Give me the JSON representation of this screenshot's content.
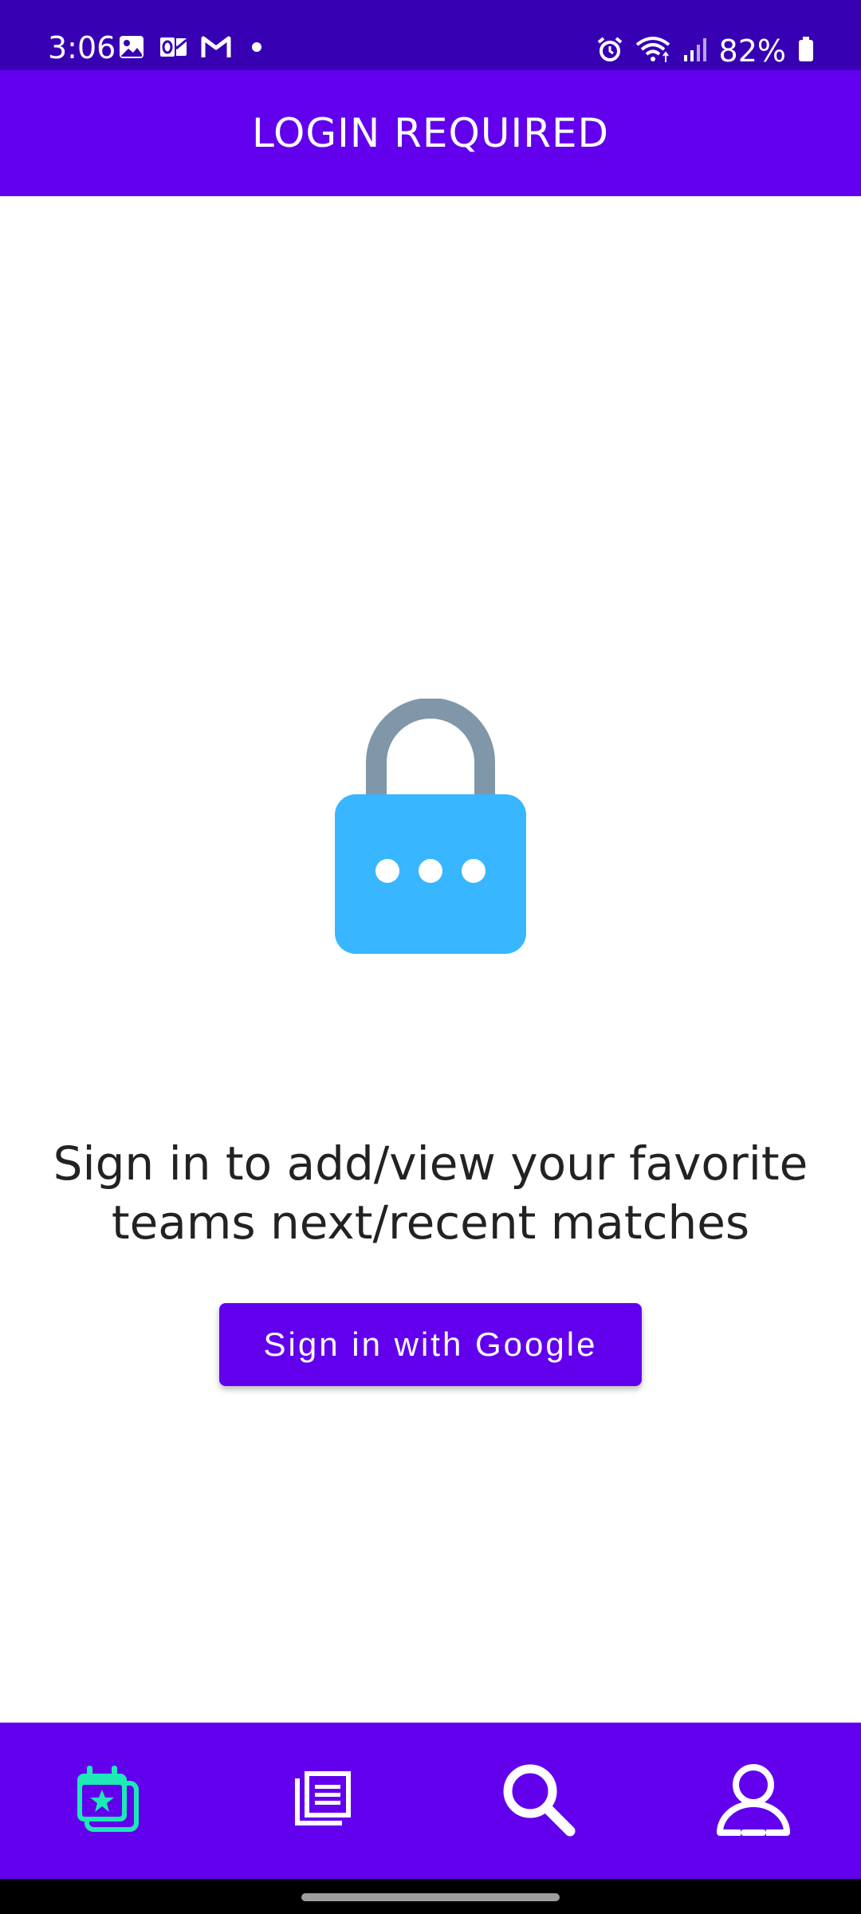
{
  "status_bar": {
    "time": "3:06",
    "left_icons": [
      "gallery-icon",
      "outlook-icon",
      "gmail-icon",
      "notification-dot-icon"
    ],
    "right_icons": [
      "alarm-icon",
      "wifi-icon",
      "signal-icon",
      "battery-icon"
    ],
    "battery": "82%"
  },
  "app_bar": {
    "title": "LOGIN REQUIRED"
  },
  "main": {
    "illustration": "lock-icon",
    "message": "Sign in to add/view your favorite teams next/recent matches",
    "signin_button": "Sign in with Google"
  },
  "bottom_nav": {
    "items": [
      {
        "icon": "calendar-star-icon",
        "active": true
      },
      {
        "icon": "news-icon",
        "active": false
      },
      {
        "icon": "search-icon",
        "active": false
      },
      {
        "icon": "profile-icon",
        "active": false
      }
    ]
  },
  "colors": {
    "status_bar": "#3700b3",
    "primary": "#6200ee",
    "active_nav": "#1de9b6",
    "lock_body": "#38b6ff",
    "lock_shackle": "#7f97a8",
    "text": "#222222"
  }
}
